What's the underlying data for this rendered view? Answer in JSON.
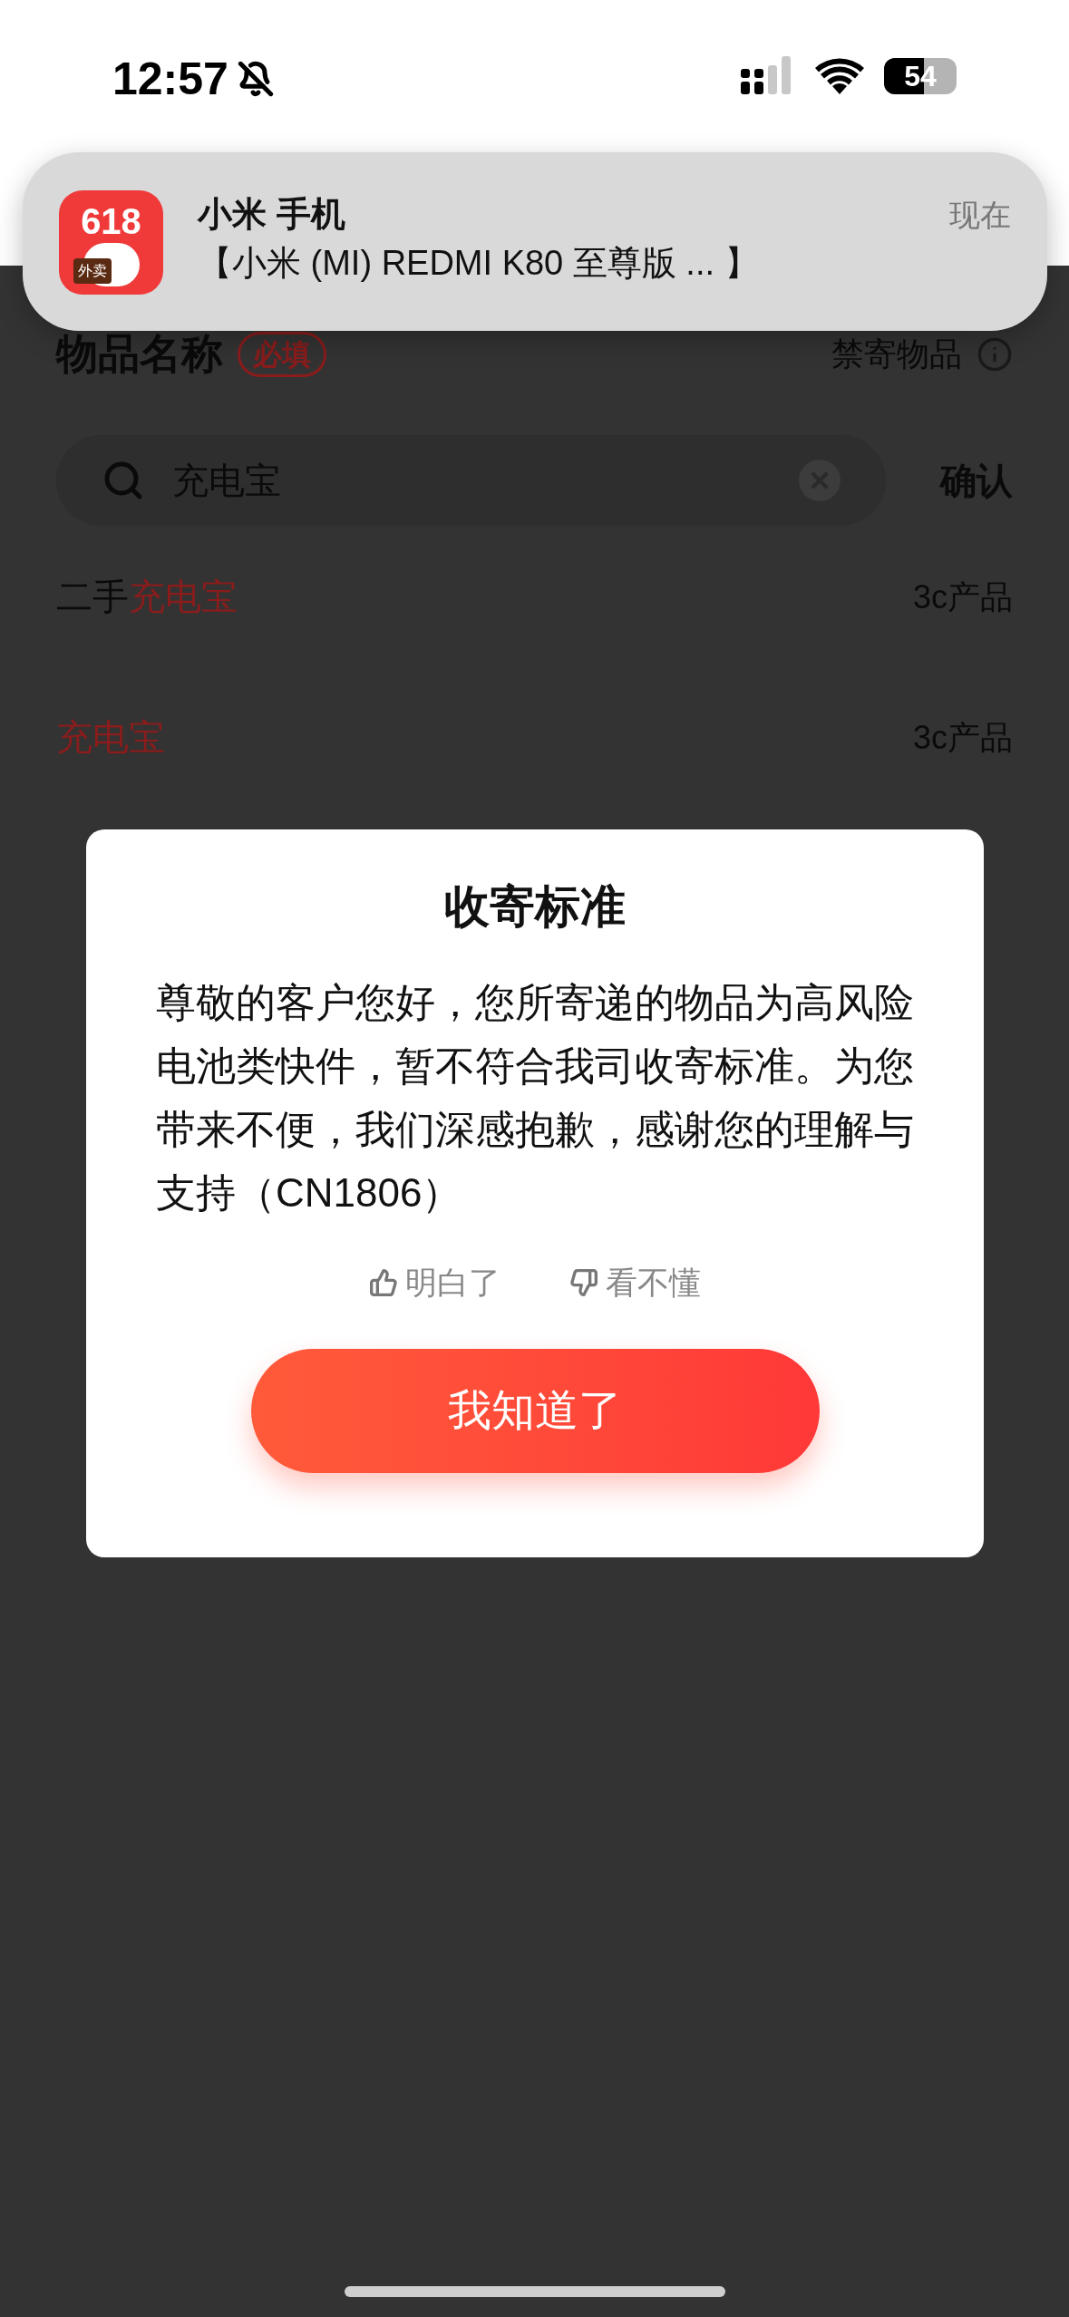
{
  "status_bar": {
    "time": "12:57",
    "muted": true,
    "battery": "54"
  },
  "notification": {
    "title": "小米 手机",
    "body": "【小米 (MI) REDMI K80 至尊版 ... 】",
    "time": "现在",
    "app_icon": {
      "badge": "618",
      "tag": "外卖"
    }
  },
  "section": {
    "title": "物品名称",
    "required_badge": "必填",
    "link": "禁寄物品"
  },
  "search": {
    "value": "充电宝",
    "confirm": "确认"
  },
  "results": [
    {
      "parts": [
        {
          "text": "二手",
          "highlight": false
        },
        {
          "text": "充电宝",
          "highlight": true
        }
      ],
      "category": "3c产品"
    },
    {
      "parts": [
        {
          "text": "充电宝",
          "highlight": true
        }
      ],
      "category": "3c产品"
    }
  ],
  "dialog": {
    "title": "收寄标准",
    "message": "尊敬的客户您好，您所寄递的物品为高风险电池类快件，暂不符合我司收寄标准。为您带来不便，我们深感抱歉，感谢您的理解与支持（CN1806）",
    "feedback": [
      {
        "kind": "up",
        "label": "明白了"
      },
      {
        "kind": "down",
        "label": "看不懂"
      }
    ],
    "button": "我知道了"
  }
}
